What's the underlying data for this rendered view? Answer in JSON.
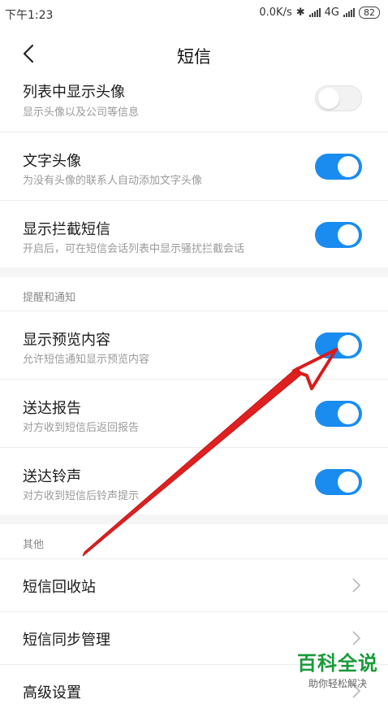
{
  "status_bar": {
    "time": "下午1:23",
    "network_speed": "0.0K/s",
    "network_type": "4G",
    "battery": "82"
  },
  "header": {
    "title": "短信",
    "back_icon": "chevron-left-icon"
  },
  "settings": [
    {
      "title": "列表中显示头像",
      "subtitle": "显示头像以及公司等信息",
      "enabled": false
    },
    {
      "title": "文字头像",
      "subtitle": "为没有头像的联系人自动添加文字头像",
      "enabled": true
    },
    {
      "title": "显示拦截短信",
      "subtitle": "开启后，可在短信会话列表中显示骚扰拦截会话",
      "enabled": true
    }
  ],
  "notifications": {
    "section_label": "提醒和通知",
    "items": [
      {
        "title": "显示预览内容",
        "subtitle": "允许短信通知显示预览内容",
        "enabled": true
      },
      {
        "title": "送达报告",
        "subtitle": "对方收到短信后返回报告",
        "enabled": true
      },
      {
        "title": "送达铃声",
        "subtitle": "对方收到短信后铃声提示",
        "enabled": true
      }
    ]
  },
  "other": {
    "section_label": "其他",
    "items": [
      {
        "title": "短信回收站"
      },
      {
        "title": "短信同步管理"
      },
      {
        "title": "高级设置"
      }
    ]
  },
  "watermark": {
    "brand": "百科全说",
    "slogan": "助你轻松解决"
  },
  "colors": {
    "toggle_on": "#1a8cf0",
    "annotation_arrow": "#e02020",
    "watermark": "#1a9a3a"
  }
}
